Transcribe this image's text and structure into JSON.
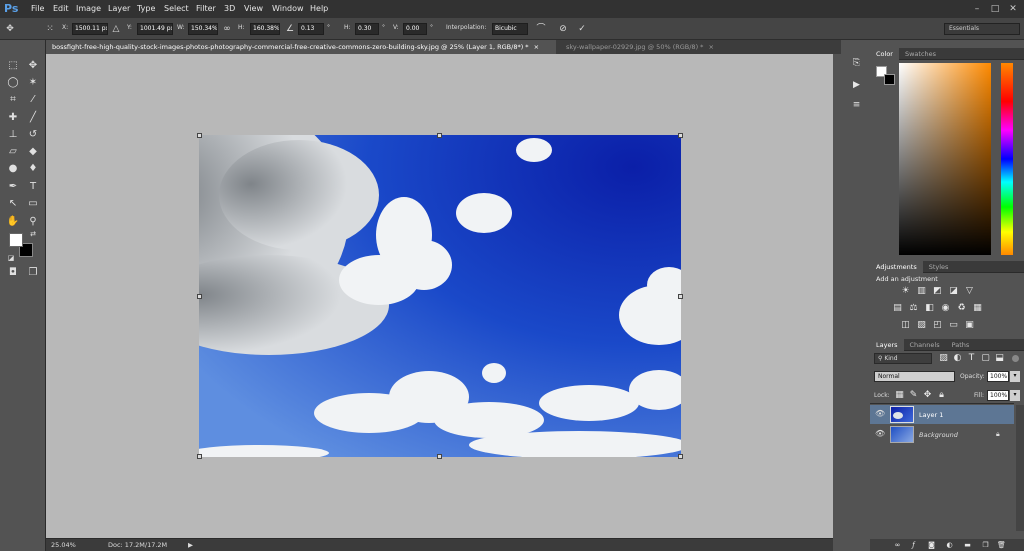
{
  "app": {
    "logo": "Ps"
  },
  "menu": [
    "File",
    "Edit",
    "Image",
    "Layer",
    "Type",
    "Select",
    "Filter",
    "3D",
    "View",
    "Window",
    "Help"
  ],
  "window": {
    "minimize": "–",
    "maximize": "□",
    "close": "✕"
  },
  "options": {
    "x_label": "X:",
    "x": "1500.11 px",
    "y_label": "Y:",
    "y": "1001.49 px",
    "w_label": "W:",
    "w": "150.34%",
    "h_label": "H:",
    "h": "160.38%",
    "angle": "0.13",
    "angle_unit": "°",
    "hskew_label": "H:",
    "hskew": "0.30",
    "hskew_unit": "°",
    "vskew_label": "V:",
    "vskew": "0.00",
    "vskew_unit": "°",
    "interp_label": "Interpolation:",
    "interp": "Bicubic"
  },
  "workspace": "Essentials",
  "tabs": [
    {
      "label": "bossfight-free-high-quality-stock-images-photos-photography-commercial-free-creative-commons-zero-building-sky.jpg @ 25% (Layer 1, RGB/8*) *",
      "close": "×"
    },
    {
      "label": "sky-wallpaper-02929.jpg @ 50% (RGB/8) *",
      "close": "×"
    }
  ],
  "status": {
    "zoom": "25.04%",
    "doc": "Doc: 17.2M/17.2M",
    "arrow": "▶"
  },
  "color_panel": {
    "tabs": [
      "Color",
      "Swatches"
    ]
  },
  "adjustments": {
    "tabs": [
      "Adjustments",
      "Styles"
    ],
    "heading": "Add an adjustment"
  },
  "layers_panel": {
    "tabs": [
      "Layers",
      "Channels",
      "Paths"
    ],
    "filter": "Kind",
    "blend": "Normal",
    "opacity_label": "Opacity:",
    "opacity": "100%",
    "lock_label": "Lock:",
    "fill_label": "Fill:",
    "fill": "100%",
    "layers": [
      {
        "name": "Layer 1"
      },
      {
        "name": "Background"
      }
    ]
  },
  "colors": {
    "accent": "#5aa0e8",
    "sky": "#1846c8",
    "selected_layer": "#5d7694"
  }
}
